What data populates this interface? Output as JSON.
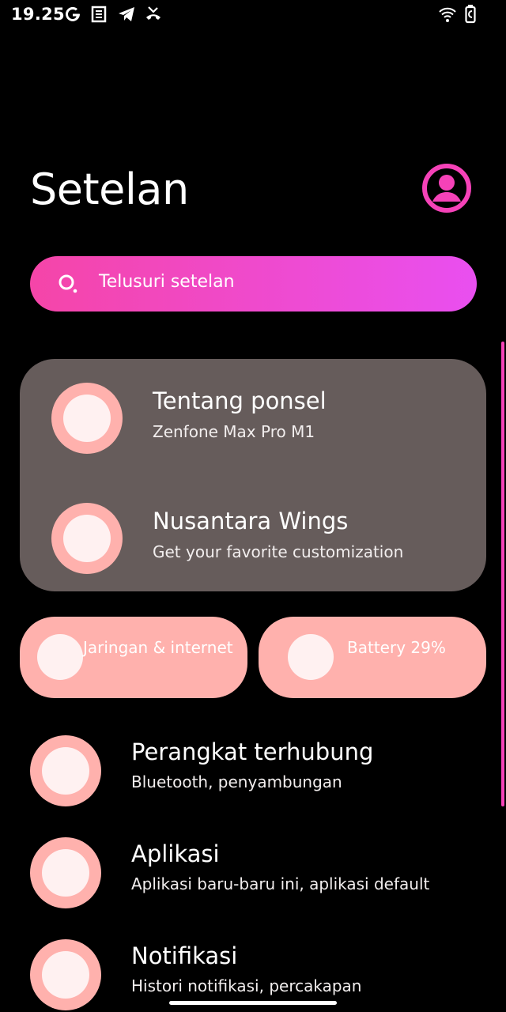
{
  "status_bar": {
    "time": "19.25",
    "left_icons": [
      "google-g-icon",
      "news-icon",
      "telegram-icon",
      "missed-call-icon"
    ],
    "right_icons": [
      "wifi-icon",
      "battery-icon"
    ]
  },
  "header": {
    "title": "Setelan",
    "profile_icon": "account-circle-icon"
  },
  "search": {
    "placeholder": "Telusuri setelan"
  },
  "card": {
    "items": [
      {
        "title": "Tentang ponsel",
        "subtitle": "Zenfone Max Pro M1"
      },
      {
        "title": "Nusantara Wings",
        "subtitle": "Get your favorite customization"
      }
    ]
  },
  "tiles": [
    {
      "label": "Jaringan & internet"
    },
    {
      "label": "Battery 29%"
    }
  ],
  "list": [
    {
      "title": "Perangkat terhubung",
      "subtitle": "Bluetooth, penyambungan"
    },
    {
      "title": "Aplikasi",
      "subtitle": "Aplikasi baru-baru ini, aplikasi default"
    },
    {
      "title": "Notifikasi",
      "subtitle": "Histori notifikasi, percakapan"
    }
  ],
  "colors": {
    "background": "#000000",
    "accent_pink": "#f542b8",
    "search_gradient_start": "#f545a8",
    "search_gradient_end": "#e94ff0",
    "card_background": "#665c5b",
    "icon_ring": "#ffb1ad",
    "icon_fill": "#fff1f1"
  }
}
